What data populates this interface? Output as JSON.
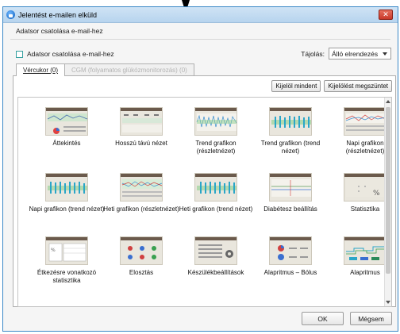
{
  "window": {
    "title": "Jelentést e-mailen elküld"
  },
  "section": {
    "label": "Adatsor csatolása e-mail-hez"
  },
  "attach": {
    "checkbox_label": "Adatsor csatolása e-mail-hez",
    "checked": false
  },
  "orientation": {
    "label": "Tájolás:",
    "value": "Álló elrendezés"
  },
  "tabs": [
    {
      "label": "Vércukor (0)",
      "active": true
    },
    {
      "label": "CGM (folyamatos glükózmonitorozás) (0)",
      "active": false,
      "disabled": true
    }
  ],
  "panel": {
    "select_all": "Kijelöl mindent",
    "deselect_all": "Kijelölést megszüntet"
  },
  "reports": [
    {
      "label": "Áttekintés",
      "icon": "overview-report-icon"
    },
    {
      "label": "Hosszú távú nézet",
      "icon": "long-term-report-icon"
    },
    {
      "label": "Trend grafikon (részletnézet)",
      "icon": "trend-detail-report-icon"
    },
    {
      "label": "Trend grafikon (trend nézet)",
      "icon": "trend-view-report-icon"
    },
    {
      "label": "Napi grafikon (részletnézet)",
      "icon": "daily-detail-report-icon"
    },
    {
      "label": "Napi grafikon (trend nézet)",
      "icon": "daily-trend-report-icon"
    },
    {
      "label": "Heti grafikon (részletnézet)",
      "icon": "weekly-detail-report-icon"
    },
    {
      "label": "Heti grafikon (trend nézet)",
      "icon": "weekly-trend-report-icon"
    },
    {
      "label": "Diabétesz beállítás",
      "icon": "diabetes-settings-report-icon"
    },
    {
      "label": "Statisztika",
      "icon": "statistics-report-icon"
    },
    {
      "label": "Étkezésre vonatkozó statisztika",
      "icon": "meal-statistics-report-icon"
    },
    {
      "label": "Elosztás",
      "icon": "distribution-report-icon"
    },
    {
      "label": "Készülékbeállítások",
      "icon": "device-settings-report-icon"
    },
    {
      "label": "Alapritmus – Bólus",
      "icon": "basal-bolus-report-icon"
    },
    {
      "label": "Alapritmus",
      "icon": "basal-rate-report-icon"
    }
  ],
  "footer": {
    "ok": "OK",
    "cancel": "Mégsem"
  },
  "colors": {
    "title_gradient_top": "#cfe3f5",
    "close_red": "#c9392a",
    "header_bar": "#6b5a4c",
    "accent_teal": "#37a1a1"
  }
}
